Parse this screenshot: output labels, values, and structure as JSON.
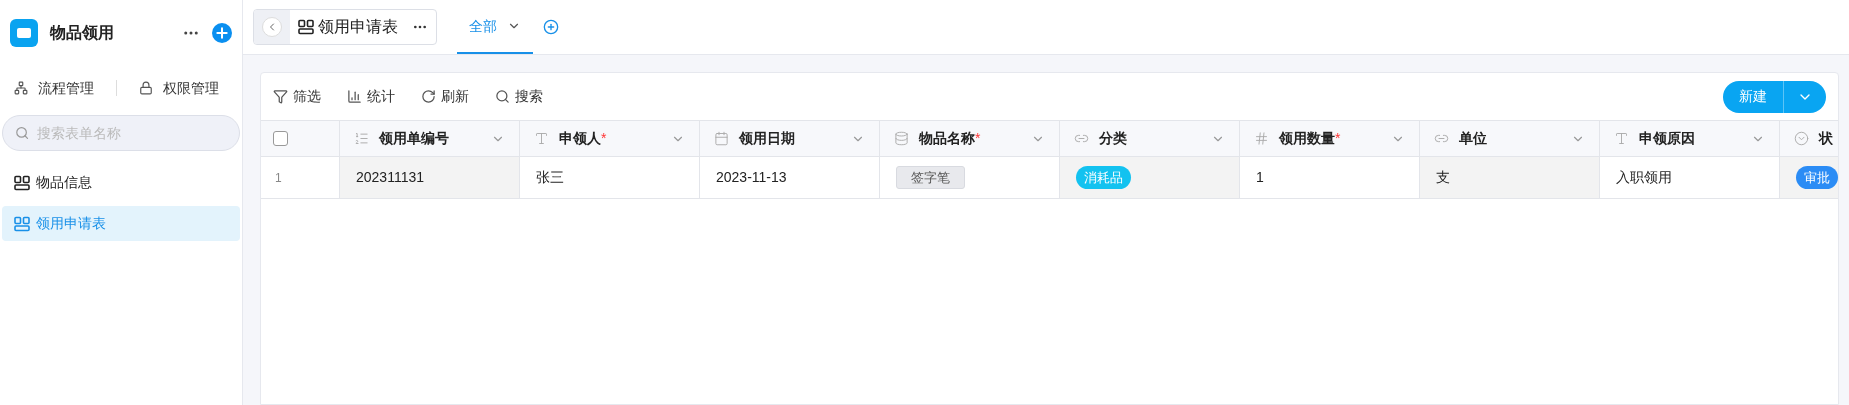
{
  "app": {
    "title": "物品领用"
  },
  "nav": [
    {
      "label": "流程管理",
      "kind": "flow"
    },
    {
      "label": "权限管理",
      "kind": "lock"
    }
  ],
  "search": {
    "placeholder": "搜索表单名称"
  },
  "forms": [
    {
      "label": "物品信息",
      "selected": false
    },
    {
      "label": "领用申请表",
      "selected": true
    }
  ],
  "page": {
    "title": "领用申请表"
  },
  "views": [
    {
      "label": "全部",
      "selected": true
    }
  ],
  "toolbar": [
    {
      "label": "筛选",
      "kind": "filter"
    },
    {
      "label": "统计",
      "kind": "chart"
    },
    {
      "label": "刷新",
      "kind": "refresh"
    },
    {
      "label": "搜索",
      "kind": "search"
    }
  ],
  "new_button": {
    "label": "新建"
  },
  "table": {
    "select_all": {
      "checked": false
    },
    "columns": [
      {
        "label": "领用单编号",
        "kind": "number"
      },
      {
        "label": "申领人",
        "kind": "text",
        "required_mark": "*"
      },
      {
        "label": "领用日期",
        "kind": "date"
      },
      {
        "label": "物品名称",
        "kind": "database",
        "required_mark": "*"
      },
      {
        "label": "分类",
        "kind": "link"
      },
      {
        "label": "领用数量",
        "kind": "counter",
        "required_mark": "*"
      },
      {
        "label": "单位",
        "kind": "link"
      },
      {
        "label": "申领原因",
        "kind": "text"
      },
      {
        "label": "状",
        "kind": "select"
      }
    ],
    "rows": [
      {
        "index": "1",
        "selected": false,
        "cells": [
          {
            "kind": "readonly",
            "text": "202311131"
          },
          {
            "kind": "text",
            "text": "张三"
          },
          {
            "kind": "text",
            "text": "2023-11-13"
          },
          {
            "kind": "tag",
            "text": "签字笔"
          },
          {
            "kind": "pill",
            "text": "消耗品",
            "color": "#13c2f0"
          },
          {
            "kind": "text",
            "text": "1"
          },
          {
            "kind": "readonly",
            "text": "支"
          },
          {
            "kind": "text",
            "text": "入职领用"
          },
          {
            "kind": "pill",
            "text": "审批",
            "color": "#2b8cf5"
          }
        ]
      }
    ]
  }
}
